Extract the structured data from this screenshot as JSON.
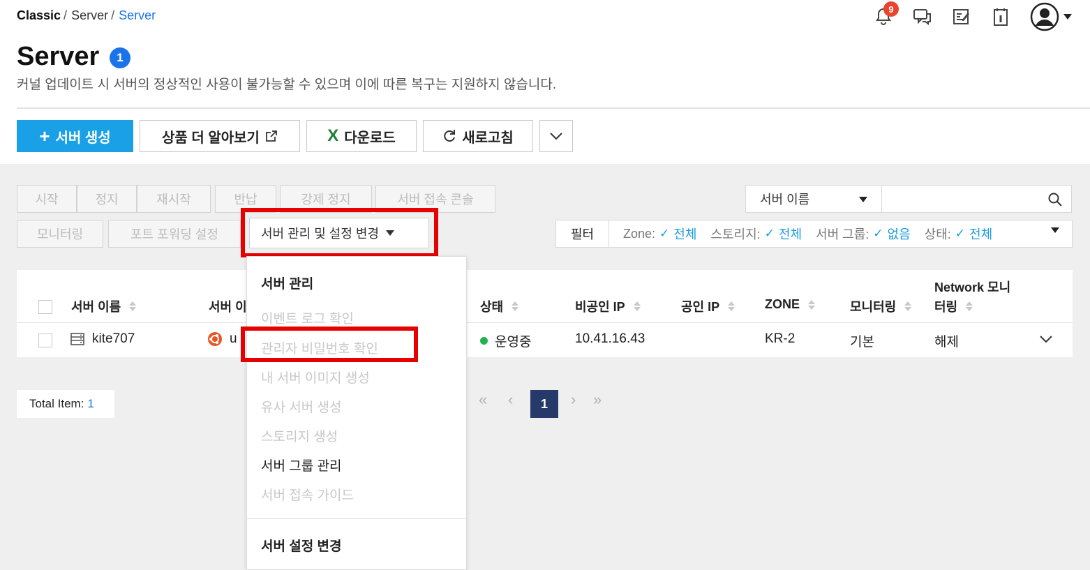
{
  "breadcrumb": {
    "root": "Classic",
    "parent": "Server",
    "current": "Server"
  },
  "header": {
    "notification_count": "9",
    "title": "Server",
    "title_badge": "1",
    "description": "커널 업데이트 시 서버의 정상적인 사용이 불가능할 수 있으며 이에 따른 복구는 지원하지 않습니다."
  },
  "toolbar": {
    "create_label": "서버 생성",
    "learn_more_label": "상품 더 알아보기",
    "download_label": "다운로드",
    "refresh_label": "새로고침"
  },
  "actions": {
    "start": "시작",
    "stop": "정지",
    "restart": "재시작",
    "return": "반납",
    "force_stop": "강제 정지",
    "console": "서버 접속 콘솔",
    "monitoring": "모니터링",
    "port_forwarding": "포트 포워딩 설정",
    "manage": "서버 관리 및 설정 변경"
  },
  "search": {
    "select_value": "서버 이름"
  },
  "filter": {
    "label": "필터",
    "zone_key": "Zone:",
    "zone_val": "전체",
    "storage_key": "스토리지:",
    "storage_val": "전체",
    "group_key": "서버 그룹:",
    "group_val": "없음",
    "status_key": "상태:",
    "status_val": "전체"
  },
  "table": {
    "headers": {
      "name": "서버 이름",
      "image": "서버 이",
      "status": "상태",
      "private_ip": "비공인 IP",
      "public_ip": "공인 IP",
      "zone": "ZONE",
      "monitoring": "모니터링",
      "network_line1": "Network 모니",
      "network_line2": "터링"
    },
    "rows": [
      {
        "name": "kite707",
        "image": "u",
        "status": "운영중",
        "private_ip": "10.41.16.43",
        "public_ip": "",
        "zone": "KR-2",
        "monitoring": "기본",
        "network": "해제"
      }
    ]
  },
  "footer": {
    "total_label": "Total Item:",
    "total_value": "1",
    "current_page": "1"
  },
  "dropdown": {
    "group1": "서버 관리",
    "event_log": "이벤트 로그 확인",
    "admin_password": "관리자 비밀번호 확인",
    "create_image": "내 서버 이미지 생성",
    "similar_server": "유사 서버 생성",
    "create_storage": "스토리지 생성",
    "group_manage": "서버 그룹 관리",
    "access_guide": "서버 접속 가이드",
    "group2": "서버 설정 변경"
  },
  "colors": {
    "primary": "#1aa0e6",
    "link": "#1a73e8",
    "highlight": "#e60000",
    "running": "#22b14c",
    "page": "#263a6a"
  }
}
